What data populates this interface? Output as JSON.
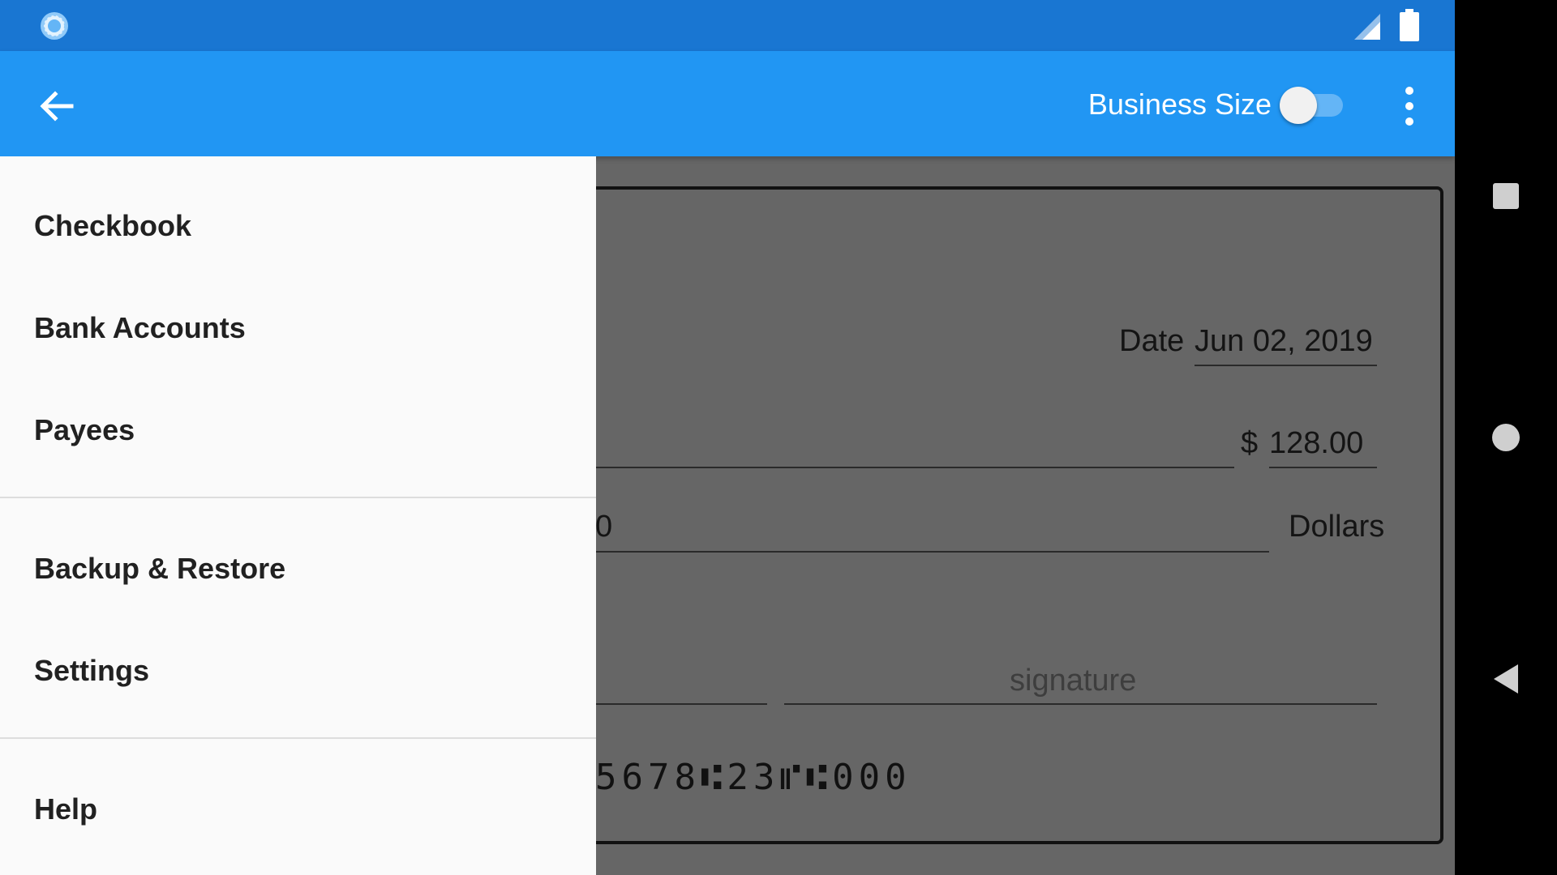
{
  "status_bar": {
    "app_icon": "spinner-icon",
    "signal_icon": "signal-icon",
    "battery_icon": "battery-icon"
  },
  "app_bar": {
    "back_icon": "arrow-left-icon",
    "business_size_label": "Business Size",
    "business_size_toggle": {
      "on": false
    },
    "overflow_icon": "more-vert-icon",
    "color": "#2196F3",
    "status_color": "#1976D2"
  },
  "drawer": {
    "items": [
      {
        "label": "Checkbook"
      },
      {
        "label": "Bank Accounts"
      },
      {
        "label": "Payees"
      },
      {
        "label": "Backup & Restore"
      },
      {
        "label": "Settings"
      },
      {
        "label": "Help"
      }
    ]
  },
  "check": {
    "date_label": "Date",
    "date_value": "Jun 02, 2019",
    "currency_symbol": "$",
    "amount": "128.00",
    "written_amount_partial": "0",
    "dollars_label": "Dollars",
    "signature_placeholder": "signature",
    "micr_line": "5678⑆23⑈⑆000"
  },
  "nav_bar": {
    "recent_icon": "square-icon",
    "home_icon": "circle-icon",
    "back_icon": "triangle-back-icon"
  }
}
